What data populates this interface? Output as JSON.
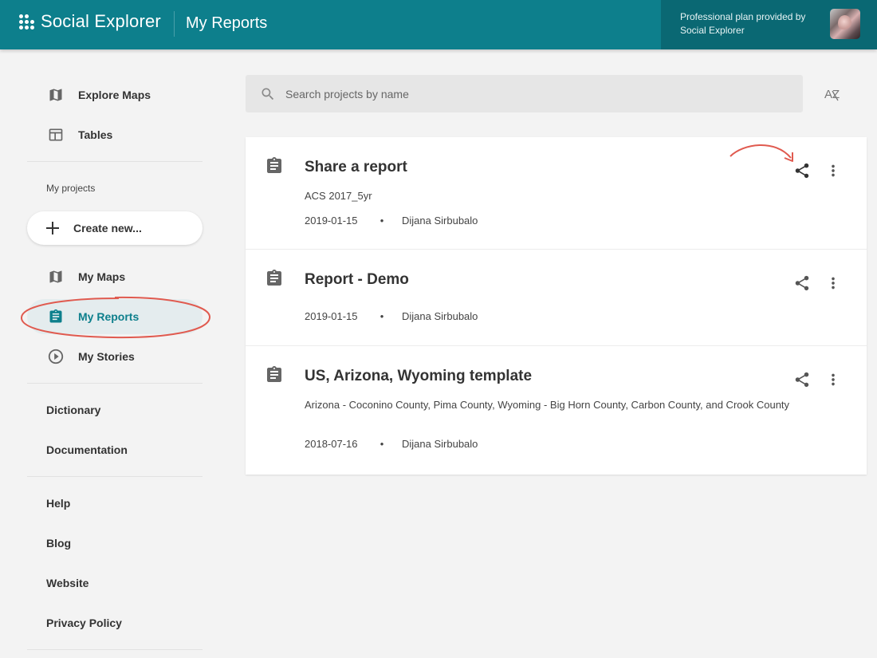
{
  "header": {
    "logo_text": "Social Explorer",
    "title": "My Reports",
    "plan_text": "Professional plan provided by Social Explorer",
    "avatar_icon": "user-avatar"
  },
  "sidebar": {
    "top_items": [
      {
        "label": "Explore Maps",
        "icon": "map-icon"
      },
      {
        "label": "Tables",
        "icon": "table-icon"
      }
    ],
    "projects_label": "My projects",
    "create_label": "Create new...",
    "project_items": [
      {
        "label": "My Maps",
        "icon": "map-icon"
      },
      {
        "label": "My Reports",
        "icon": "report-icon",
        "active": true
      },
      {
        "label": "My Stories",
        "icon": "play-circle-icon"
      }
    ],
    "resource_items": [
      {
        "label": "Dictionary"
      },
      {
        "label": "Documentation"
      }
    ],
    "footer_items": [
      {
        "label": "Help"
      },
      {
        "label": "Blog"
      },
      {
        "label": "Website"
      },
      {
        "label": "Privacy Policy"
      }
    ]
  },
  "search": {
    "placeholder": "Search projects by name",
    "value": ""
  },
  "sort_button": {
    "label": "AZ",
    "icon": "sort-az-icon"
  },
  "reports": [
    {
      "title": "Share a report",
      "subtitle": "ACS 2017_5yr",
      "date": "2019-01-15",
      "separator": "•",
      "author": "Dijana Sirbubalo"
    },
    {
      "title": "Report - Demo",
      "subtitle": "",
      "date": "2019-01-15",
      "separator": "•",
      "author": "Dijana Sirbubalo"
    },
    {
      "title": "US, Arizona, Wyoming template",
      "subtitle": "Arizona - Coconino County, Pima County, Wyoming - Big Horn County, Carbon County, and Crook County",
      "date": "2018-07-16",
      "separator": "•",
      "author": "Dijana Sirbubalo"
    }
  ],
  "colors": {
    "header_bg": "#0d7f8c",
    "plan_bg": "#0a6873",
    "accent": "#0d7f8c",
    "annotation": "#e05a4f"
  }
}
